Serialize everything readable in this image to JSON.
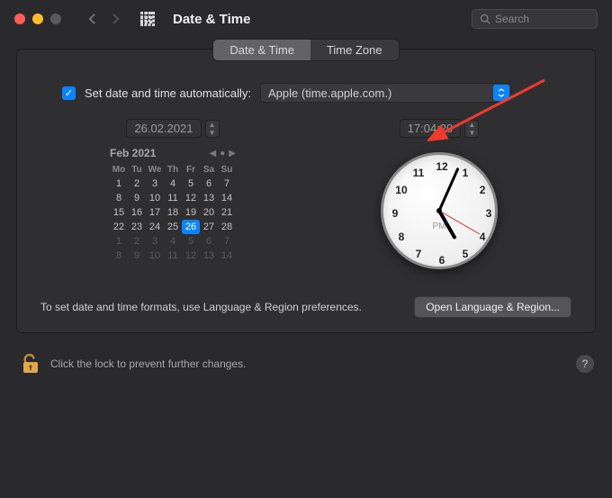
{
  "header": {
    "title": "Date & Time",
    "search_placeholder": "Search"
  },
  "tabs": {
    "date_time": "Date & Time",
    "time_zone": "Time Zone"
  },
  "auto": {
    "checked": true,
    "label": "Set date and time automatically:",
    "server": "Apple (time.apple.com.)"
  },
  "date_field": "26.02.2021",
  "time_field": "17:04:20",
  "calendar": {
    "title": "Feb 2021",
    "dow": [
      "Mo",
      "Tu",
      "We",
      "Th",
      "Fr",
      "Sa",
      "Su"
    ],
    "days": [
      {
        "n": 1
      },
      {
        "n": 2
      },
      {
        "n": 3
      },
      {
        "n": 4
      },
      {
        "n": 5
      },
      {
        "n": 6
      },
      {
        "n": 7
      },
      {
        "n": 8
      },
      {
        "n": 9
      },
      {
        "n": 10
      },
      {
        "n": 11
      },
      {
        "n": 12
      },
      {
        "n": 13
      },
      {
        "n": 14
      },
      {
        "n": 15
      },
      {
        "n": 16
      },
      {
        "n": 17
      },
      {
        "n": 18
      },
      {
        "n": 19
      },
      {
        "n": 20
      },
      {
        "n": 21
      },
      {
        "n": 22
      },
      {
        "n": 23
      },
      {
        "n": 24
      },
      {
        "n": 25
      },
      {
        "n": 26,
        "sel": true
      },
      {
        "n": 27
      },
      {
        "n": 28
      },
      {
        "n": 1,
        "dim": true
      },
      {
        "n": 2,
        "dim": true
      },
      {
        "n": 3,
        "dim": true
      },
      {
        "n": 4,
        "dim": true
      },
      {
        "n": 5,
        "dim": true
      },
      {
        "n": 6,
        "dim": true
      },
      {
        "n": 7,
        "dim": true
      },
      {
        "n": 8,
        "dim": true
      },
      {
        "n": 9,
        "dim": true
      },
      {
        "n": 10,
        "dim": true
      },
      {
        "n": 11,
        "dim": true
      },
      {
        "n": 12,
        "dim": true
      },
      {
        "n": 13,
        "dim": true
      },
      {
        "n": 14,
        "dim": true
      }
    ]
  },
  "clock": {
    "ampm": "PM",
    "numerals": [
      "12",
      "1",
      "2",
      "3",
      "4",
      "5",
      "6",
      "7",
      "8",
      "9",
      "10",
      "11"
    ],
    "hour_angle": 150,
    "minute_angle": 24,
    "second_angle": 120
  },
  "format_hint": "To set date and time formats, use Language & Region preferences.",
  "open_lang_btn": "Open Language & Region...",
  "lock_text": "Click the lock to prevent further changes.",
  "help_label": "?"
}
